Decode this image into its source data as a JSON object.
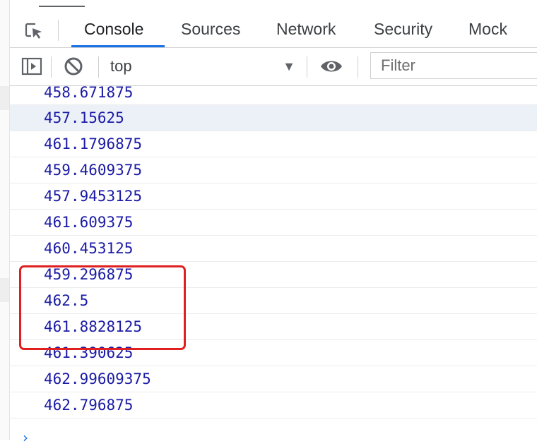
{
  "tabs": [
    {
      "label": "Console",
      "active": true
    },
    {
      "label": "Sources",
      "active": false
    },
    {
      "label": "Network",
      "active": false
    },
    {
      "label": "Security",
      "active": false
    },
    {
      "label": "Mock",
      "active": false
    }
  ],
  "toolbar": {
    "context": "top",
    "filter_placeholder": "Filter"
  },
  "log": [
    "458.671875",
    "457.15625",
    "461.1796875",
    "459.4609375",
    "457.9453125",
    "461.609375",
    "460.453125",
    "459.296875",
    "462.5",
    "461.8828125",
    "461.390625",
    "462.99609375",
    "462.796875"
  ],
  "colors": {
    "accent": "#1a73e8",
    "log_value": "#1a1aa6",
    "highlight_border": "#e02020"
  }
}
